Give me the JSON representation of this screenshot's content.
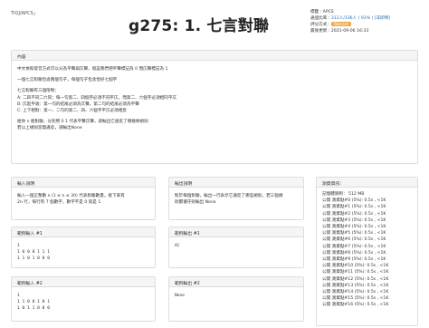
{
  "breadcrumb": "TIOJ/APCS」",
  "title": "g275: 1. 七言對聯",
  "meta": {
    "tag_label": "標籤 :",
    "tag_value": "APCS",
    "pass_label": "通過比率 :",
    "pass_value": "312人/336人 ( 93% ) [非即時]",
    "eval_label": "評分方式 :",
    "eval_value": "Tolerant",
    "date_label": "最後更新 :",
    "date_value": "2021-09-06 16:33"
  },
  "content": {
    "header": "內容",
    "lines": [
      "中文依照發音方式可以分為平聲與仄聲，假設我們把平聲標記為 0 而仄聲標記為 1",
      "一個七言對聯包含兩個句子，每個句子包含恰好七個字",
      "七言對聯有三個限制：",
      "A: 二四不同二六同：每一句第二、四個字必須不同平仄，而第二、六個字必須相同平仄",
      "B: 仄起平收：第一句的結尾必須為仄聲，第二句的結尾必須為平聲",
      "C: 上下相對：第一、二句的第二、四、六個字平仄必須相反",
      "給你 n 組對聯，分別用 0 1 代表平聲仄聲，請輸出它違反了哪幾條規則",
      "若以上規則皆無違反，請輸出None"
    ]
  },
  "input_desc": {
    "header": "輸入說明",
    "lines": [
      "輸入一個正整數 n (1 ≤ n ≤ 30) 代表對聯數量，接下來有",
      "2n 行，每行有 7 個數字，數字不是 0 就是 1"
    ]
  },
  "output_desc": {
    "header": "輸出說明",
    "lines": [
      "對於每個對聯，輸出一行表示它違反了哪些規則，若三個規",
      "則都遵守則輸出 None"
    ]
  },
  "test_info": {
    "header": "測資資訊：",
    "memory": "記憶體限制： 512 MB",
    "rows": [
      "公開 測資點#0 (5%): 0.5s , <1K",
      "公開 測資點#1 (5%): 0.5s , <1K",
      "公開 測資點#2 (5%): 0.5s , <1K",
      "公開 測資點#3 (5%): 0.5s , <1K",
      "公開 測資點#4 (5%): 0.5s , <1K",
      "公開 測資點#5 (5%): 0.5s , <1K",
      "公開 測資點#6 (5%): 0.5s , <1K",
      "公開 測資點#7 (5%): 0.5s , <1K",
      "公開 測資點#8 (5%): 0.5s , <1K",
      "公開 測資點#9 (5%): 0.5s , <1K",
      "公開 測資點#10 (5%): 0.5s , <1K",
      "公開 測資點#11 (5%): 0.5s , <1K",
      "公開 測資點#12 (5%): 0.5s , <1K",
      "公開 測資點#13 (5%): 0.5s , <1K",
      "公開 測資點#14 (5%): 0.5s , <1K",
      "公開 測資點#15 (5%): 0.5s , <1K",
      "公開 測資點#16 (5%): 0.5s , <1K"
    ]
  },
  "sample_in_1": {
    "header": "範例輸入 #1",
    "lines": [
      "1",
      "1 0 0 0 1 1 1",
      "1 1 0 1 0 0 0"
    ]
  },
  "sample_out_1": {
    "header": "範例輸出 #1",
    "lines": [
      "AC"
    ]
  },
  "sample_in_2": {
    "header": "範例輸入 #2",
    "lines": [
      "1",
      "1 1 0 0 1 0 1",
      "1 0 1 1 0 0 0"
    ]
  },
  "sample_out_2": {
    "header": "範例輸出 #2",
    "lines": [
      "None"
    ]
  }
}
